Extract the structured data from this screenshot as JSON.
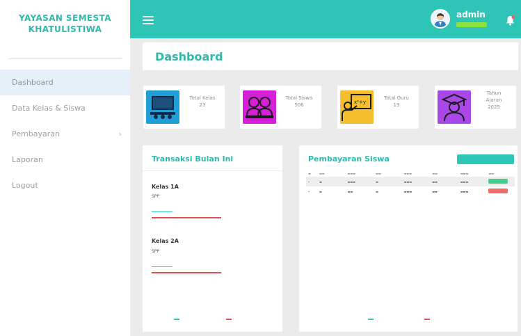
{
  "brand": {
    "line1": "YAYASAN SEMESTA",
    "line2": "KHATULISTIWA"
  },
  "menu": [
    {
      "label": "Dashboard"
    },
    {
      "label": "Data Kelas & Siswa"
    },
    {
      "label": "Pembayaran",
      "chevron": "›"
    },
    {
      "label": "Laporan"
    },
    {
      "label": "Logout"
    }
  ],
  "header": {
    "user_name": "admin"
  },
  "page": {
    "title": "Dashboard"
  },
  "stats": [
    {
      "line1": "Total Kelas",
      "line2": "23",
      "icon": "classroom-icon",
      "color": "#1f9ed8"
    },
    {
      "line1": "Total Siswa",
      "line2": "506",
      "icon": "students-icon",
      "color": "#d61fd9"
    },
    {
      "line1": "Total Guru",
      "line2": "13",
      "icon": "teacher-icon",
      "color": "#f4be2c"
    },
    {
      "line1": "Tahun",
      "line2": "Ajaran",
      "line3": "2025",
      "icon": "graduate-icon",
      "color": "#a947e8"
    }
  ],
  "transaksi": {
    "title": "Transaksi Bulan Ini",
    "groups": [
      {
        "class": "Kelas 1A",
        "label": "SPP",
        "value": ""
      },
      {
        "class": "Kelas 2A",
        "label": "SPP",
        "value": ""
      }
    ]
  },
  "pembayaran": {
    "title": "Pembayaran Siswa"
  },
  "colors": {
    "accent": "#2ec4b6",
    "brand_text": "#2fb9ad",
    "alert": "#e44d4d"
  }
}
